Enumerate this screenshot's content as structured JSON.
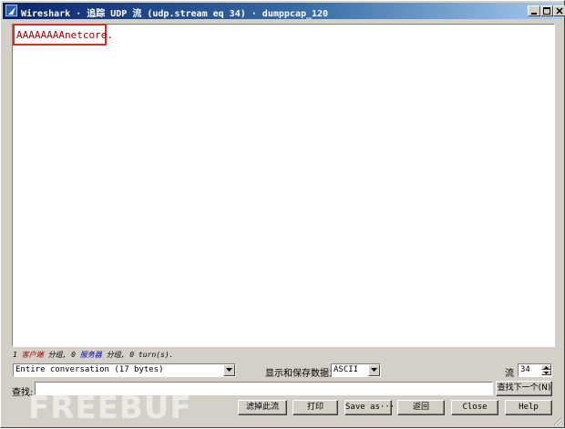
{
  "window": {
    "title": "Wireshark · 追踪 UDP 流 (udp.stream eq 34) · dumppcap_120"
  },
  "stream": {
    "content": "AAAAAAAAnetcore."
  },
  "summary": {
    "client_count": "1",
    "client_label": "客户端",
    "packets_word_1": "分组,",
    "server_count": "0",
    "server_label": "服务器",
    "packets_word_2": "分组,",
    "turns": "0 turn(s)."
  },
  "controls": {
    "conversation_select": "Entire conversation (17 bytes)",
    "format_label": "显示和保存数据为",
    "format_select": "ASCII",
    "stream_label": "流",
    "stream_number": "34",
    "find_label": "查找:",
    "find_value": "",
    "find_next": "查找下一个(N)"
  },
  "buttons": {
    "filter_out": "滤掉此流",
    "print": "打印",
    "save_as": "Save as···",
    "back": "返回",
    "close": "Close",
    "help": "Help"
  },
  "watermark": "FREEBUF",
  "colors": {
    "client_text": "#a30000",
    "server_text": "#0000a8",
    "highlight": "#d32f2f",
    "titlebar_start": "#0a246a"
  },
  "icons": [
    "wireshark-fin-icon",
    "minimize-icon",
    "maximize-icon",
    "close-icon",
    "chevron-down-icon",
    "chevron-up-icon",
    "resize-grip-icon"
  ]
}
